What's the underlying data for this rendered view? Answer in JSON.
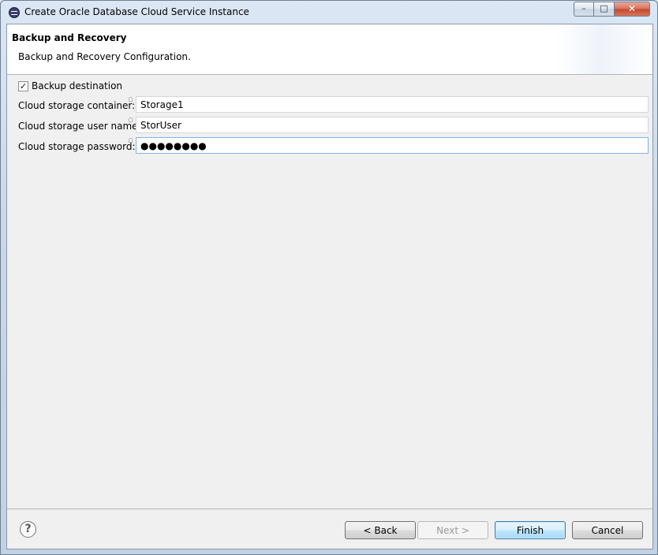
{
  "window": {
    "title": "Create Oracle Database Cloud Service Instance",
    "controls": {
      "minimize": "–",
      "maximize": "□",
      "close": "✕"
    }
  },
  "header": {
    "title": "Backup and Recovery",
    "description": "Backup and Recovery Configuration."
  },
  "form": {
    "backup_destination": {
      "label": "Backup destination",
      "checked": true,
      "check_glyph": "✓"
    },
    "fields": [
      {
        "label": "Cloud storage container:",
        "value": "Storage1"
      },
      {
        "label": "Cloud storage user name:",
        "value": "StorUser"
      },
      {
        "label": "Cloud storage password:",
        "value": "●●●●●●●●"
      }
    ]
  },
  "footer": {
    "help_glyph": "?",
    "back_label": "< Back",
    "next_label": "Next >",
    "finish_label": "Finish",
    "cancel_label": "Cancel"
  },
  "icons": {
    "app": "eclipse-icon",
    "help": "help-icon",
    "field_hint": "content-assist-hint-icon"
  },
  "colors": {
    "focus_border": "#7eb4ea",
    "default_button": "#3c7fb1"
  }
}
